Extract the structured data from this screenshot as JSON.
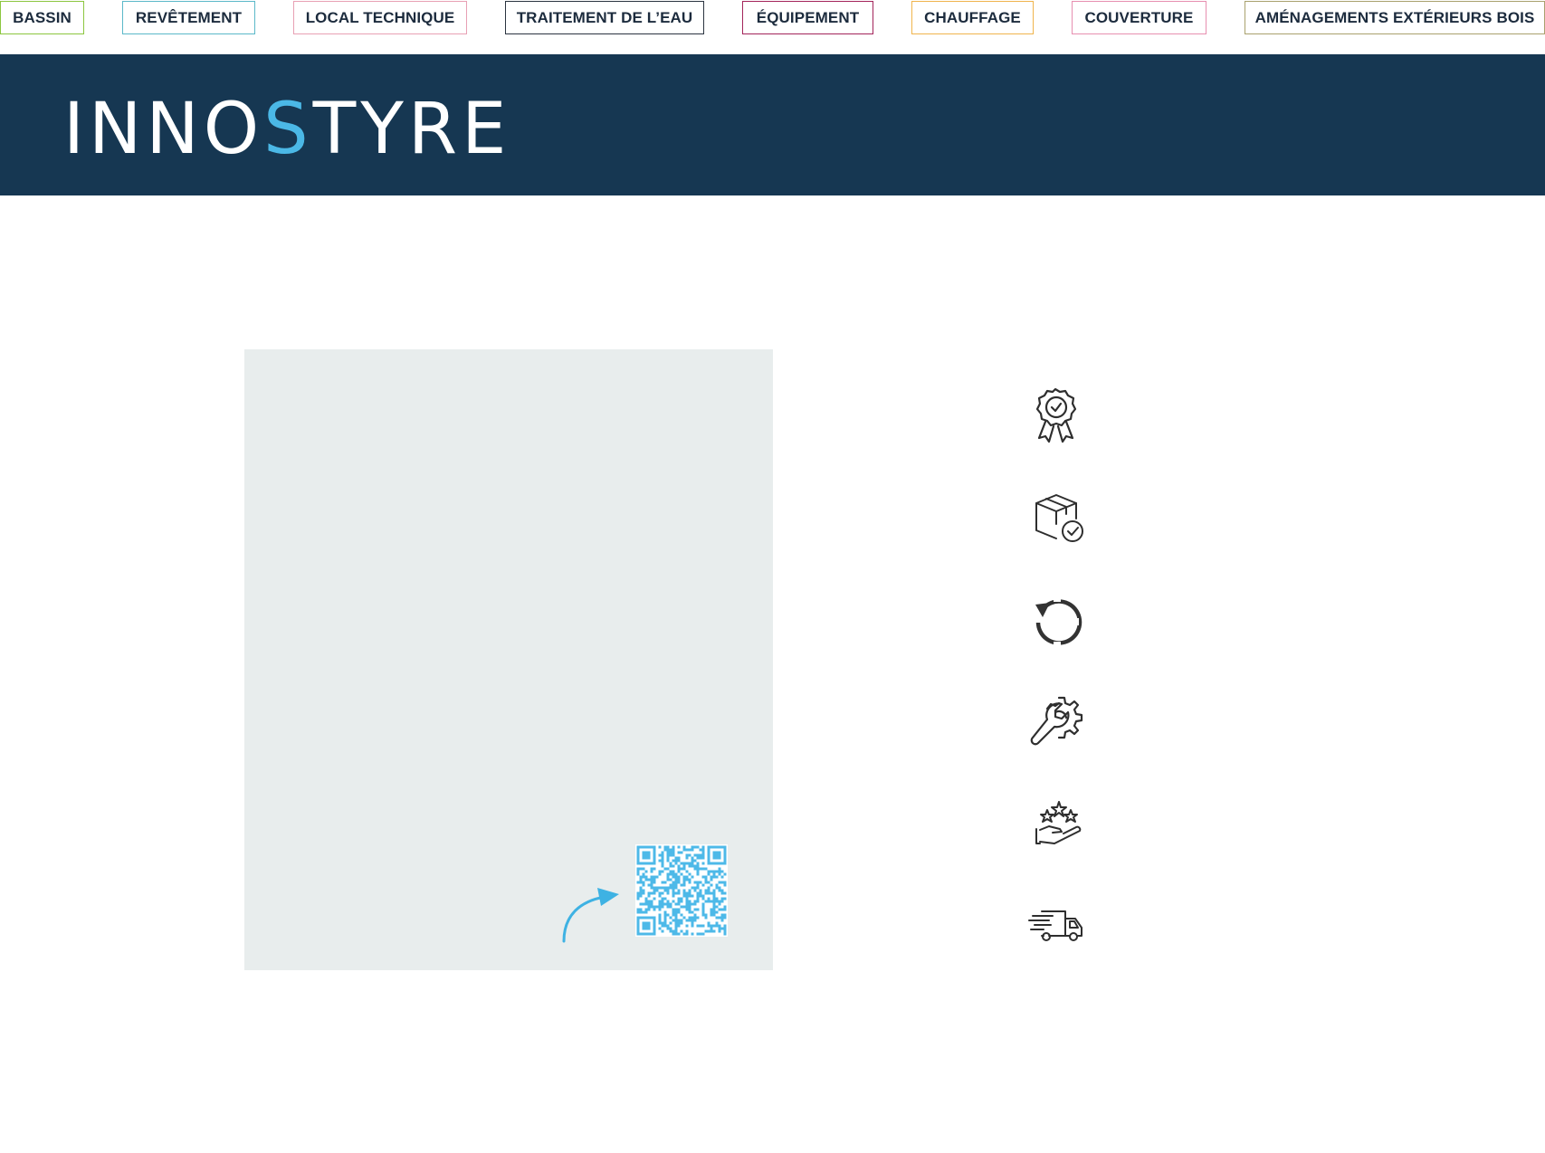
{
  "nav": {
    "tabs": [
      {
        "label": "BASSIN",
        "color": "#8cc63f"
      },
      {
        "label": "REVÊTEMENT",
        "color": "#5bb8c9"
      },
      {
        "label": "LOCAL TECHNIQUE",
        "color": "#e8a0b4"
      },
      {
        "label": "TRAITEMENT DE L’EAU",
        "color": "#2b3440"
      },
      {
        "label": "ÉQUIPEMENT",
        "color": "#a3245a"
      },
      {
        "label": "CHAUFFAGE",
        "color": "#f0b44c"
      },
      {
        "label": "COUVERTURE",
        "color": "#e78fb0"
      },
      {
        "label": "AMÉNAGEMENTS EXTÉRIEURS BOIS",
        "color": "#a9a16e"
      }
    ]
  },
  "brand": {
    "logo_part1": "INNO",
    "logo_accent": "S",
    "logo_part2": "TYRE",
    "bar_color": "#163752",
    "accent_color": "#4bb8e6"
  },
  "panel": {
    "background": "#e8eded",
    "qr_icon": "qr-code",
    "arrow_icon": "curved-arrow-icon"
  },
  "features": {
    "icons": [
      "award-badge-icon",
      "package-check-icon",
      "refresh-icon",
      "wrench-gear-icon",
      "hand-stars-icon",
      "delivery-truck-icon"
    ]
  }
}
